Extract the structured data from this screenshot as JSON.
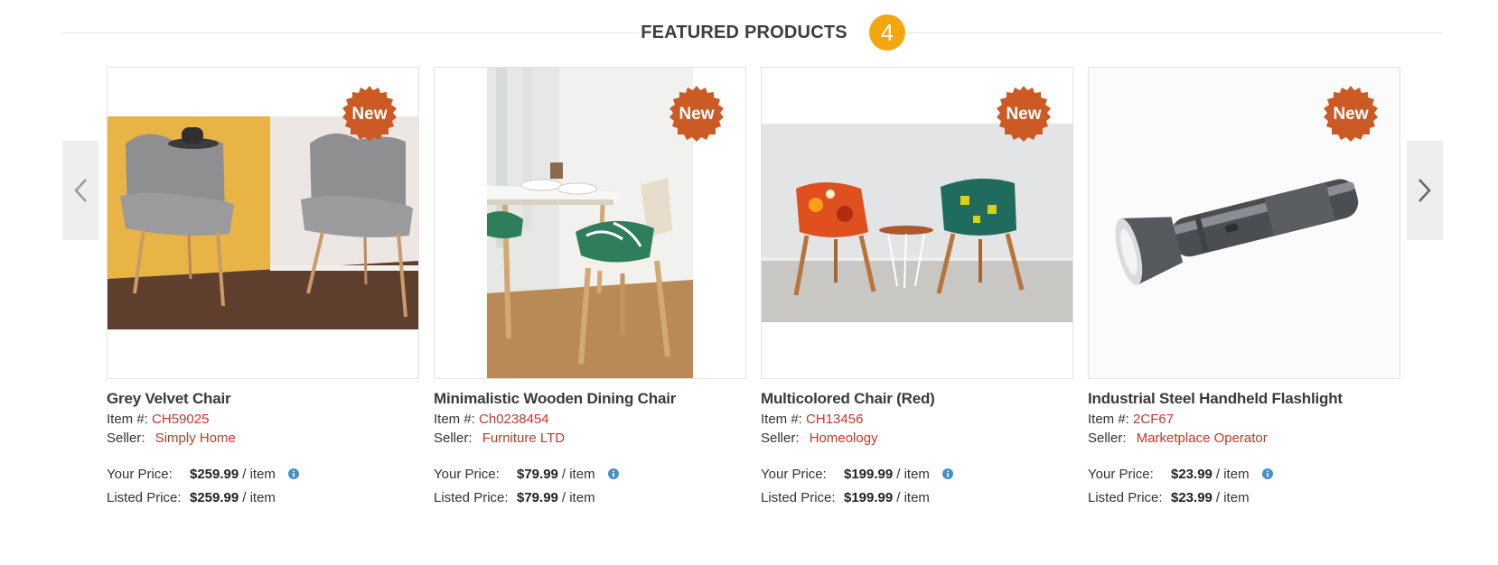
{
  "section": {
    "title": "FEATURED PRODUCTS",
    "count": "4"
  },
  "colors": {
    "accent_badge": "#f4a60e",
    "new_badge": "#cc5a25",
    "link_red": "#c0392b",
    "info_blue": "#4a90c2"
  },
  "labels": {
    "item_prefix": "Item #:",
    "seller_prefix": "Seller:",
    "your_price": "Your Price:",
    "listed_price": "Listed Price:",
    "per_item": "/ item",
    "new_badge": "New"
  },
  "products": [
    {
      "name": "Grey Velvet Chair",
      "item_no": "CH59025",
      "seller": "Simply Home",
      "your_price": "$259.99",
      "listed_price": "$259.99",
      "badge": "New"
    },
    {
      "name": "Minimalistic Wooden Dining Chair",
      "item_no": "Ch0238454",
      "seller": "Furniture LTD",
      "your_price": "$79.99",
      "listed_price": "$79.99",
      "badge": "New"
    },
    {
      "name": "Multicolored Chair (Red)",
      "item_no": "CH13456",
      "seller": "Homeology",
      "your_price": "$199.99",
      "listed_price": "$199.99",
      "badge": "New"
    },
    {
      "name": "Industrial Steel Handheld Flashlight",
      "item_no": "2CF67",
      "seller": "Marketplace Operator",
      "your_price": "$23.99",
      "listed_price": "$23.99",
      "badge": "New"
    }
  ],
  "icons": {
    "prev": "chevron-left-icon",
    "next": "chevron-right-icon",
    "info": "info-icon"
  }
}
